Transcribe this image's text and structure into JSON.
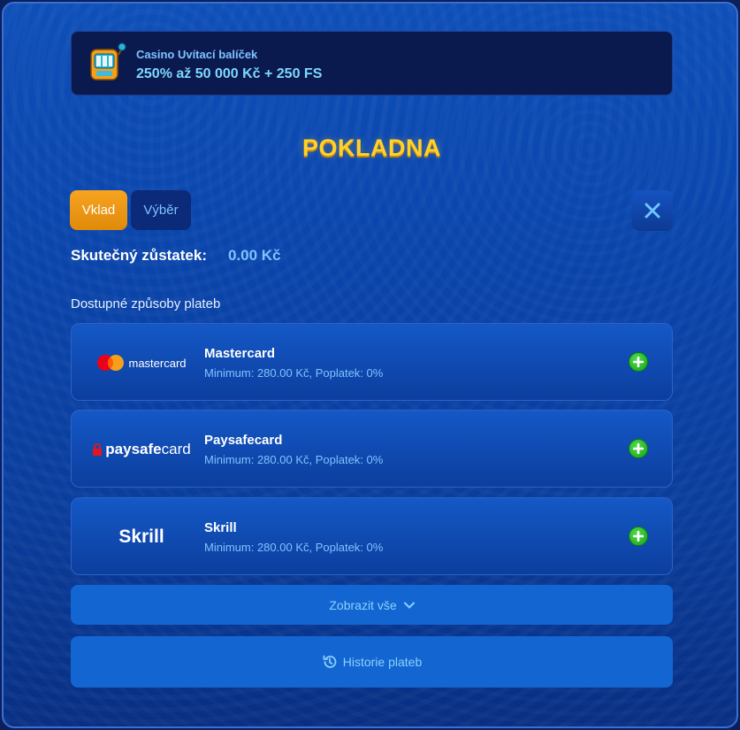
{
  "promo": {
    "subtitle": "Casino Uvítací balíček",
    "headline": "250% až 50 000 Kč + 250 FS",
    "icon": "slot-machine-icon"
  },
  "cashier": {
    "title": "POKLADNA",
    "tabs": [
      {
        "label": "Vklad",
        "active": true
      },
      {
        "label": "Výběr",
        "active": false
      }
    ],
    "close_icon": "close-icon",
    "balance_label": "Skutečný zůstatek:",
    "balance_value": "0.00 Kč",
    "methods_heading": "Dostupné způsoby plateb"
  },
  "methods": [
    {
      "name": "Mastercard",
      "logo_text": "mastercard",
      "details": "Minimum: 280.00 Kč, Poplatek: 0%"
    },
    {
      "name": "Paysafecard",
      "logo_text_a": "paysafe",
      "logo_text_b": "card",
      "details": "Minimum: 280.00 Kč, Poplatek: 0%"
    },
    {
      "name": "Skrill",
      "logo_text": "Skrill",
      "details": "Minimum: 280.00 Kč, Poplatek: 0%"
    }
  ],
  "actions": {
    "show_all_label": "Zobrazit vše",
    "history_label": "Historie plateb"
  },
  "colors": {
    "accent_orange": "#f7a420",
    "title_yellow": "#ffd12a",
    "link_blue": "#7fc3ff",
    "add_green": "#17a31c"
  }
}
